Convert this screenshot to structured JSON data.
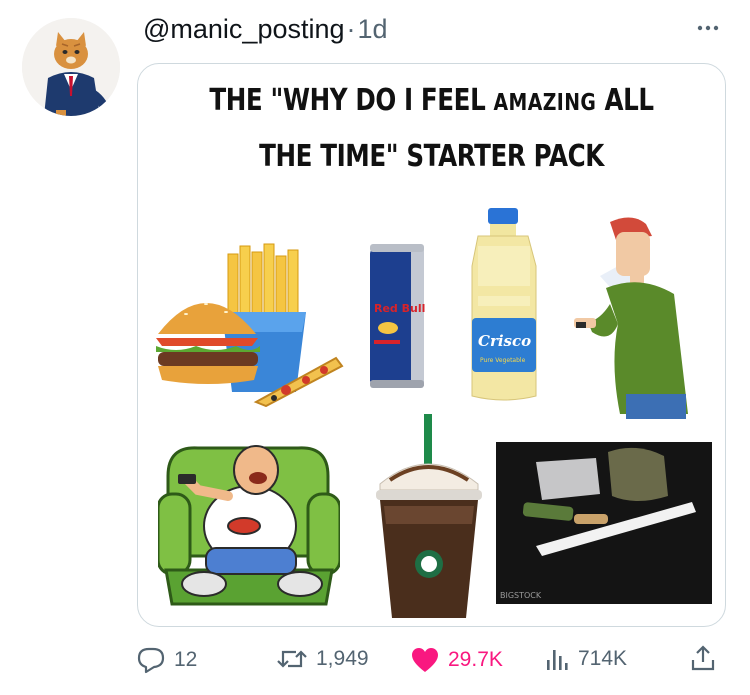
{
  "tweet": {
    "handle": "@manic_posting",
    "separator": "·",
    "time": "1d",
    "avatar_icon": "cat-in-suit-avatar",
    "more_icon": "more-horizontal-icon"
  },
  "meme": {
    "title_line1_a": "THE \"WHY DO I FEEL",
    "title_line1_b": "AMAZING",
    "title_line1_c": "ALL",
    "title_line2": "THE TIME\" STARTER PACK",
    "can_label": "Red Bull",
    "bottle_label": "Crisco",
    "bottle_sublabel": "Pure Vegetable",
    "watermark": "BIGSTOCK",
    "items": [
      "fast-food",
      "energy-drink",
      "vegetable-oil",
      "phone-user",
      "couch-eater",
      "frappuccino",
      "drugs-photo"
    ]
  },
  "actions": {
    "reply_count": "12",
    "retweet_count": "1,949",
    "like_count": "29.7K",
    "view_count": "714K",
    "like_color": "#f91880",
    "muted_color": "#536471"
  }
}
